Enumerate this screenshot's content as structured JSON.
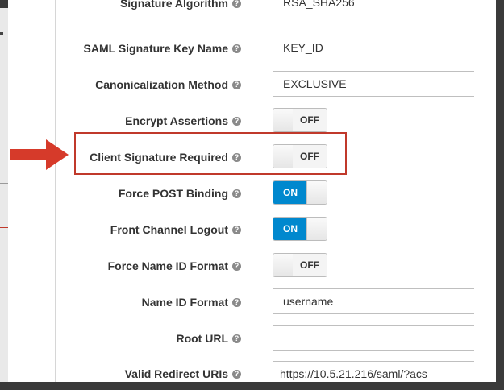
{
  "form": {
    "rows": [
      {
        "label": "Signature Algorithm",
        "type": "text",
        "value": "RSA_SHA256"
      },
      {
        "label": "SAML Signature Key Name",
        "type": "text",
        "value": "KEY_ID"
      },
      {
        "label": "Canonicalization Method",
        "type": "text",
        "value": "EXCLUSIVE"
      },
      {
        "label": "Encrypt Assertions",
        "type": "toggle",
        "state": "OFF"
      },
      {
        "label": "Client Signature Required",
        "type": "toggle",
        "state": "OFF"
      },
      {
        "label": "Force POST Binding",
        "type": "toggle",
        "state": "ON"
      },
      {
        "label": "Front Channel Logout",
        "type": "toggle",
        "state": "ON"
      },
      {
        "label": "Force Name ID Format",
        "type": "toggle",
        "state": "OFF"
      },
      {
        "label": "Name ID Format",
        "type": "text",
        "value": "username"
      },
      {
        "label": "Root URL",
        "type": "text",
        "value": ""
      },
      {
        "label": "Valid Redirect URIs",
        "type": "text",
        "value": "https://10.5.21.216/saml/?acs"
      }
    ]
  },
  "icons": {
    "help": "question-circle-icon",
    "arrow": "red-arrow-icon"
  },
  "colors": {
    "toggle_on": "#0088ce",
    "highlight": "#c0392b"
  }
}
